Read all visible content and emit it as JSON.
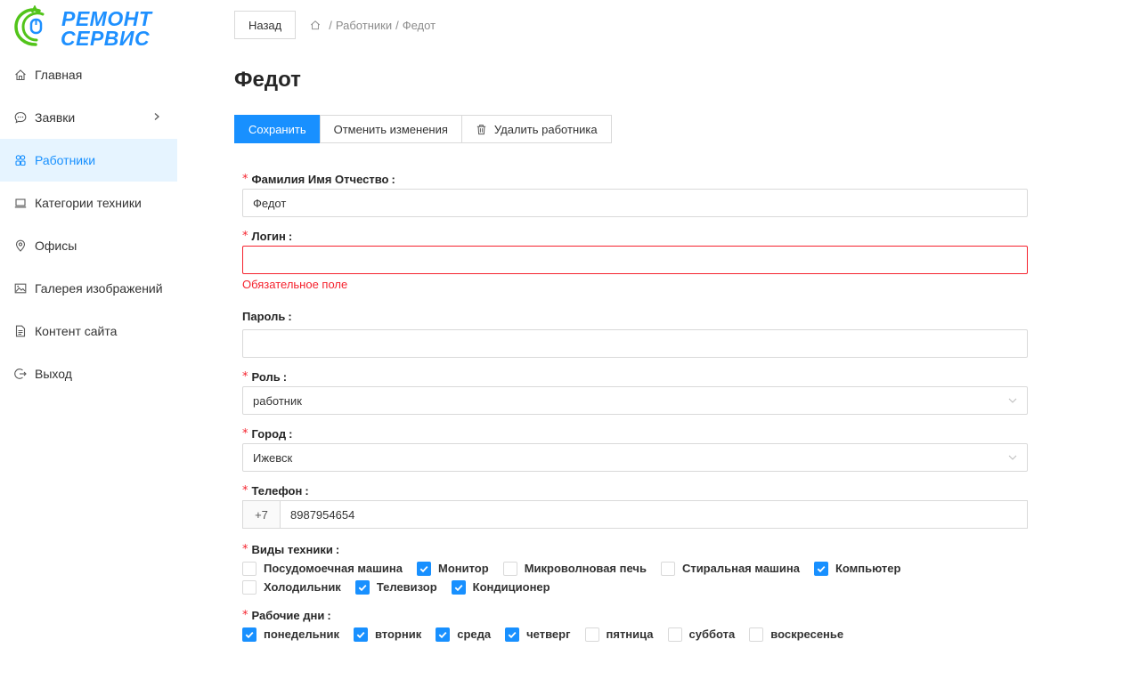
{
  "brand": {
    "line1": "РЕМОНТ",
    "line2": "СЕРВИС",
    "color": "#1e90ff",
    "accent": "#52c41a"
  },
  "sidebar": {
    "items": [
      {
        "label": "Главная",
        "icon": "home-icon"
      },
      {
        "label": "Заявки",
        "icon": "message-icon",
        "has_submenu": true
      },
      {
        "label": "Работники",
        "icon": "team-icon",
        "active": true
      },
      {
        "label": "Категории техники",
        "icon": "laptop-icon"
      },
      {
        "label": "Офисы",
        "icon": "location-icon"
      },
      {
        "label": "Галерея изображений",
        "icon": "picture-icon"
      },
      {
        "label": "Контент сайта",
        "icon": "file-icon"
      },
      {
        "label": "Выход",
        "icon": "logout-icon"
      }
    ]
  },
  "header": {
    "back_label": "Назад",
    "breadcrumb": [
      "Работники",
      "Федот"
    ],
    "separator": "/"
  },
  "page": {
    "title": "Федот"
  },
  "actions": {
    "save": "Сохранить",
    "cancel": "Отменить изменения",
    "delete": "Удалить работника"
  },
  "form": {
    "full_name": {
      "label": "Фамилия Имя Отчество",
      "value": "Федот",
      "required": true
    },
    "login": {
      "label": "Логин",
      "value": "",
      "required": true,
      "error": "Обязательное поле"
    },
    "password": {
      "label": "Пароль",
      "value": "",
      "required": false
    },
    "role": {
      "label": "Роль",
      "value": "работник",
      "required": true
    },
    "city": {
      "label": "Город",
      "value": "Ижевск",
      "required": true
    },
    "phone": {
      "label": "Телефон",
      "prefix": "+7",
      "value": "8987954654",
      "required": true
    },
    "equipment": {
      "label": "Виды техники",
      "options": [
        {
          "label": "Посудомоечная машина",
          "checked": false
        },
        {
          "label": "Монитор",
          "checked": true
        },
        {
          "label": "Микроволновая печь",
          "checked": false
        },
        {
          "label": "Стиральная машина",
          "checked": false
        },
        {
          "label": "Компьютер",
          "checked": true
        },
        {
          "label": "Холодильник",
          "checked": false
        },
        {
          "label": "Телевизор",
          "checked": true
        },
        {
          "label": "Кондиционер",
          "checked": true
        }
      ]
    },
    "workdays": {
      "label": "Рабочие дни",
      "options": [
        {
          "label": "понедельник",
          "checked": true
        },
        {
          "label": "вторник",
          "checked": true
        },
        {
          "label": "среда",
          "checked": true
        },
        {
          "label": "четверг",
          "checked": true
        },
        {
          "label": "пятница",
          "checked": false
        },
        {
          "label": "суббота",
          "checked": false
        },
        {
          "label": "воскресенье",
          "checked": false
        }
      ]
    }
  },
  "colors": {
    "primary": "#1890ff",
    "error": "#f5222d",
    "active_bg": "#e6f4ff"
  }
}
